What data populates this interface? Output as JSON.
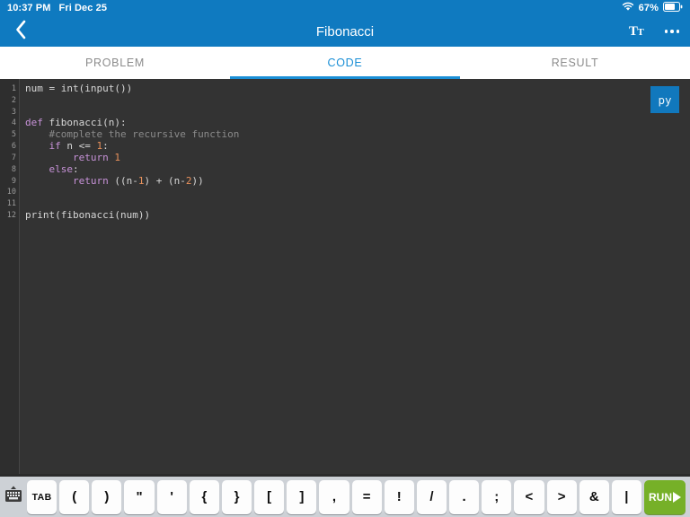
{
  "status_bar": {
    "time": "10:37 PM",
    "date": "Fri Dec 25",
    "wifi_icon": "wifi-icon",
    "battery_percent": "67%",
    "battery_icon": "battery-icon"
  },
  "nav_bar": {
    "back_icon": "chevron-left-icon",
    "title": "Fibonacci",
    "text_size_icon": "text-size-icon",
    "text_size_label": "T",
    "text_size_sub": "T",
    "more_icon": "ellipsis-icon"
  },
  "tabs": [
    {
      "label": "PROBLEM",
      "active": false
    },
    {
      "label": "CODE",
      "active": true
    },
    {
      "label": "RESULT",
      "active": false
    }
  ],
  "editor": {
    "language_badge": "py",
    "line_numbers": [
      "1",
      "2",
      "3",
      "4",
      "5",
      "6",
      "7",
      "8",
      "9",
      "10",
      "11",
      "12"
    ],
    "lines": [
      {
        "n": 1,
        "text": "num = int(input())"
      },
      {
        "n": 2,
        "text": ""
      },
      {
        "n": 3,
        "text": ""
      },
      {
        "n": 4,
        "text": "def fibonacci(n):"
      },
      {
        "n": 5,
        "text": "    #complete the recursive function"
      },
      {
        "n": 6,
        "text": "    if n <= 1:"
      },
      {
        "n": 7,
        "text": "        return 1"
      },
      {
        "n": 8,
        "text": "    else:"
      },
      {
        "n": 9,
        "text": "        return ((n-1) + (n-2))"
      },
      {
        "n": 10,
        "text": ""
      },
      {
        "n": 11,
        "text": ""
      },
      {
        "n": 12,
        "text": "print(fibonacci(num))"
      }
    ]
  },
  "accessory_bar": {
    "dismiss_keyboard_icon": "keyboard-dismiss-icon",
    "keys": [
      "TAB",
      "(",
      ")",
      "\"",
      "'",
      "{",
      "}",
      "[",
      "]",
      ",",
      "=",
      "!",
      "/",
      ".",
      ";",
      "<",
      ">",
      "&",
      "|"
    ],
    "run_label": "RUN",
    "run_icon": "play-icon"
  },
  "colors": {
    "accent": "#1a8fd6",
    "nav_background": "#0f7ac0",
    "editor_background": "#333333",
    "gutter_background": "#2e2e2e",
    "keyword": "#c792d8",
    "number": "#e8915c",
    "comment": "#8b8b8b",
    "code_text": "#d6d6d6",
    "run_button": "#76b028",
    "accessory_background": "#cdd1d6"
  }
}
